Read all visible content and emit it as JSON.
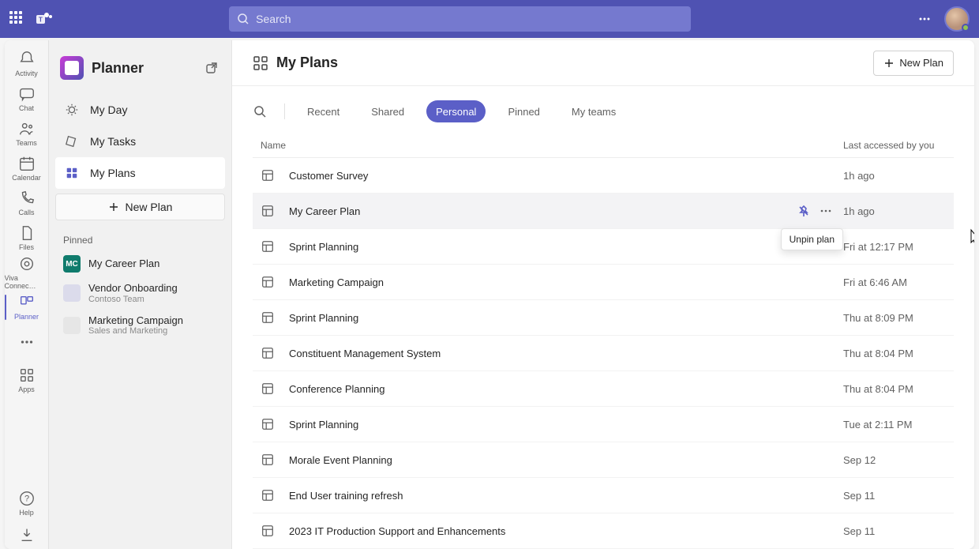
{
  "topbar": {
    "search_placeholder": "Search"
  },
  "rail": {
    "items": [
      {
        "label": "Activity"
      },
      {
        "label": "Chat"
      },
      {
        "label": "Teams"
      },
      {
        "label": "Calendar"
      },
      {
        "label": "Calls"
      },
      {
        "label": "Files"
      },
      {
        "label": "Viva Connec…"
      },
      {
        "label": "Planner"
      }
    ],
    "help_label": "Help",
    "apps_label": "Apps"
  },
  "leftPane": {
    "app_name": "Planner",
    "nav": {
      "my_day": "My Day",
      "my_tasks": "My Tasks",
      "my_plans": "My Plans"
    },
    "new_plan_label": "New Plan",
    "pinned_label": "Pinned",
    "pinned": [
      {
        "title": "My Career Plan",
        "sub": "",
        "badge": "MC",
        "color": "#0f7b6c"
      },
      {
        "title": "Vendor Onboarding",
        "sub": "Contoso Team",
        "badge": " ",
        "color": "#dbdbeb"
      },
      {
        "title": "Marketing Campaign",
        "sub": "Sales and Marketing",
        "badge": " ",
        "color": "#e6e6e6"
      }
    ]
  },
  "main": {
    "title": "My Plans",
    "new_plan": "New Plan",
    "tabs": {
      "recent": "Recent",
      "shared": "Shared",
      "personal": "Personal",
      "pinned": "Pinned",
      "myteams": "My teams"
    },
    "columns": {
      "name": "Name",
      "last": "Last accessed by you"
    },
    "tooltip": "Unpin plan",
    "rows": [
      {
        "name": "Customer Survey",
        "time": "1h ago"
      },
      {
        "name": "My Career Plan",
        "time": "1h ago",
        "hovered": true
      },
      {
        "name": "Sprint Planning",
        "time": "Fri at 12:17 PM"
      },
      {
        "name": "Marketing Campaign",
        "time": "Fri at 6:46 AM"
      },
      {
        "name": "Sprint Planning",
        "time": "Thu at 8:09 PM"
      },
      {
        "name": "Constituent Management System",
        "time": "Thu at 8:04 PM"
      },
      {
        "name": "Conference Planning",
        "time": "Thu at 8:04 PM"
      },
      {
        "name": "Sprint Planning",
        "time": "Tue at 2:11 PM"
      },
      {
        "name": "Morale Event Planning",
        "time": "Sep 12"
      },
      {
        "name": "End User training refresh",
        "time": "Sep 11"
      },
      {
        "name": "2023 IT Production Support and Enhancements",
        "time": "Sep 11"
      }
    ]
  }
}
